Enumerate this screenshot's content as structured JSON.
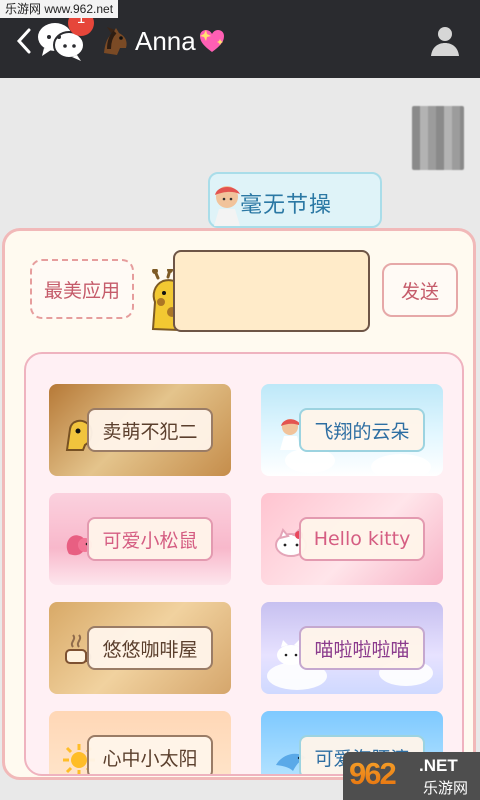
{
  "watermark": {
    "text": "乐游网 www.962.net"
  },
  "header": {
    "unread_count": "1",
    "contact_name": "Anna"
  },
  "chat": {
    "sent_message": "毫无节操"
  },
  "composer": {
    "style_label": "最美应用",
    "send_label": "发送"
  },
  "themes": [
    {
      "label": "卖萌不犯二"
    },
    {
      "label": "飞翔的云朵"
    },
    {
      "label": "可爱小松鼠"
    },
    {
      "label": "Hello kitty"
    },
    {
      "label": "悠悠咖啡屋"
    },
    {
      "label": "喵啦啦啦喵"
    },
    {
      "label": "心中小太阳"
    },
    {
      "label": "可爱海豚滴"
    }
  ],
  "site_mark": {
    "main": "962",
    "domain": ".NET",
    "cn": "乐游网"
  },
  "icons": {
    "back": "chevron-left-icon",
    "chat": "chat-bubbles-icon",
    "horse": "horse-emoji-icon",
    "heart": "sparkling-heart-icon",
    "profile": "person-icon"
  },
  "colors": {
    "topbar": "#2a2b2f",
    "badge": "#e6463a",
    "panel_border": "#f1b9b9",
    "accent_text": "#c55b6a"
  }
}
